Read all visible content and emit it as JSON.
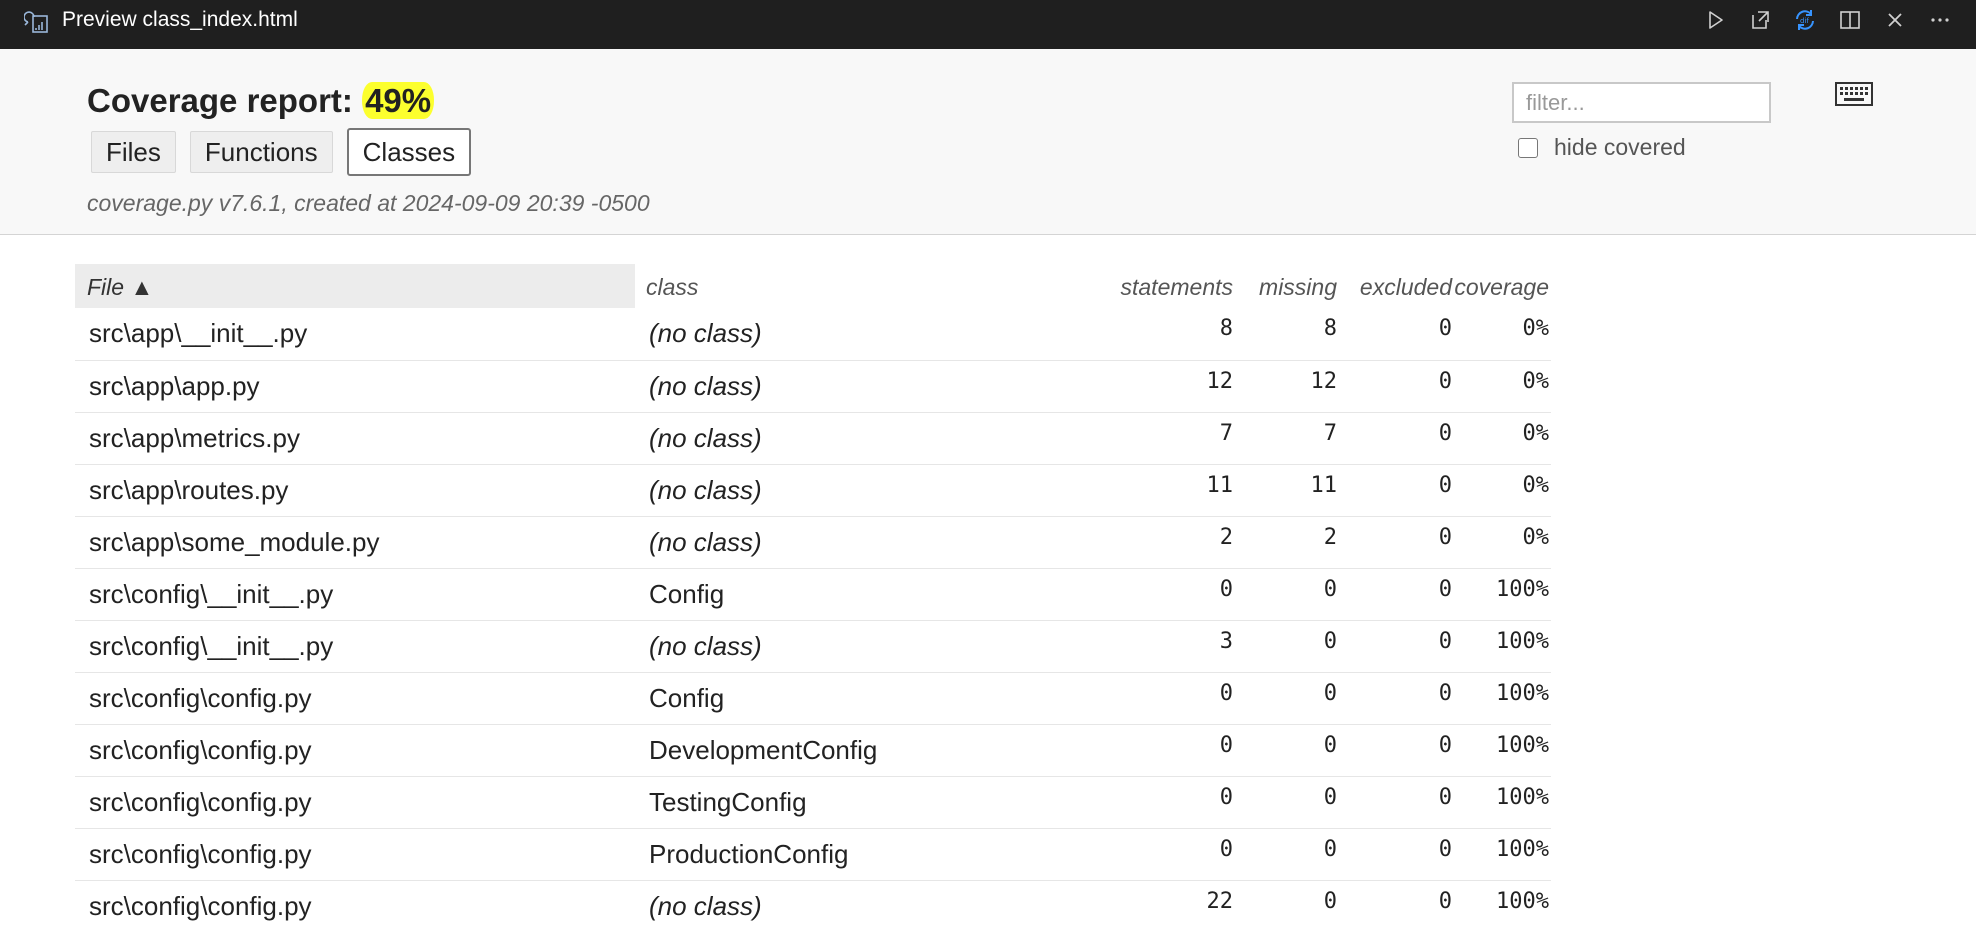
{
  "window": {
    "title": "Preview class_index.html",
    "icons": [
      "preview-icon",
      "run-icon",
      "open-external-icon",
      "sync-scroll-icon",
      "split-editor-icon",
      "close-icon",
      "more-icon"
    ]
  },
  "header": {
    "title_prefix": "Coverage report: ",
    "percent": "49%",
    "tabs": [
      "Files",
      "Functions",
      "Classes"
    ],
    "active_tab": "Classes",
    "meta": "coverage.py v7.6.1, created at 2024-09-09 20:39 -0500",
    "filter_placeholder": "filter...",
    "hide_covered_label": "hide covered",
    "highlight_color": "#fcff2e"
  },
  "table": {
    "headers": {
      "file": "File ▲",
      "class": "class",
      "statements": "statements",
      "missing": "missing",
      "excluded": "excluded",
      "coverage": "coverage"
    },
    "rows": [
      {
        "file": "src\\app\\__init__.py",
        "class": "(no class)",
        "statements": "8",
        "missing": "8",
        "excluded": "0",
        "coverage": "0%"
      },
      {
        "file": "src\\app\\app.py",
        "class": "(no class)",
        "statements": "12",
        "missing": "12",
        "excluded": "0",
        "coverage": "0%"
      },
      {
        "file": "src\\app\\metrics.py",
        "class": "(no class)",
        "statements": "7",
        "missing": "7",
        "excluded": "0",
        "coverage": "0%"
      },
      {
        "file": "src\\app\\routes.py",
        "class": "(no class)",
        "statements": "11",
        "missing": "11",
        "excluded": "0",
        "coverage": "0%"
      },
      {
        "file": "src\\app\\some_module.py",
        "class": "(no class)",
        "statements": "2",
        "missing": "2",
        "excluded": "0",
        "coverage": "0%"
      },
      {
        "file": "src\\config\\__init__.py",
        "class": "Config",
        "statements": "0",
        "missing": "0",
        "excluded": "0",
        "coverage": "100%"
      },
      {
        "file": "src\\config\\__init__.py",
        "class": "(no class)",
        "statements": "3",
        "missing": "0",
        "excluded": "0",
        "coverage": "100%"
      },
      {
        "file": "src\\config\\config.py",
        "class": "Config",
        "statements": "0",
        "missing": "0",
        "excluded": "0",
        "coverage": "100%"
      },
      {
        "file": "src\\config\\config.py",
        "class": "DevelopmentConfig",
        "statements": "0",
        "missing": "0",
        "excluded": "0",
        "coverage": "100%"
      },
      {
        "file": "src\\config\\config.py",
        "class": "TestingConfig",
        "statements": "0",
        "missing": "0",
        "excluded": "0",
        "coverage": "100%"
      },
      {
        "file": "src\\config\\config.py",
        "class": "ProductionConfig",
        "statements": "0",
        "missing": "0",
        "excluded": "0",
        "coverage": "100%"
      },
      {
        "file": "src\\config\\config.py",
        "class": "(no class)",
        "statements": "22",
        "missing": "0",
        "excluded": "0",
        "coverage": "100%"
      }
    ]
  }
}
